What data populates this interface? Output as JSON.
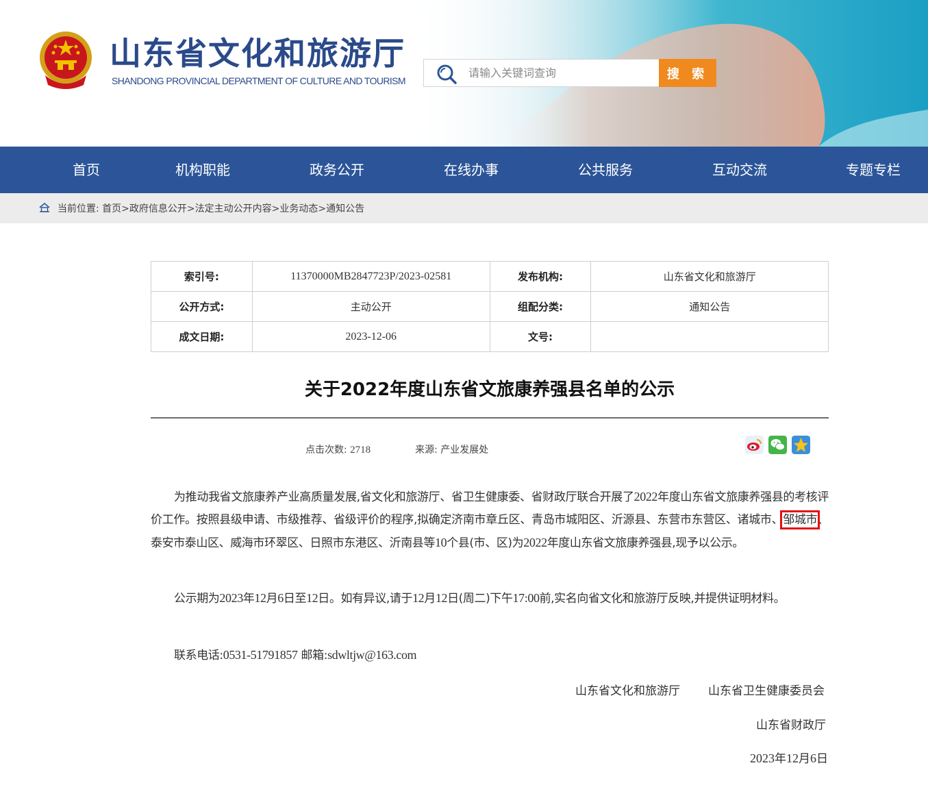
{
  "header": {
    "site_title": "山东省文化和旅游厅",
    "site_subtitle": "SHANDONG PROVINCIAL DEPARTMENT OF CULTURE AND TOURISM",
    "search_placeholder": "请输入关键词查询",
    "search_button": "搜 索",
    "emblem_icon": "national-emblem-icon",
    "colors": {
      "brand_blue": "#2a4a8a",
      "search_orange": "#f08a1e"
    }
  },
  "nav": {
    "items": [
      {
        "label": "首页"
      },
      {
        "label": "机构职能"
      },
      {
        "label": "政务公开"
      },
      {
        "label": "在线办事"
      },
      {
        "label": "公共服务"
      },
      {
        "label": "互动交流"
      },
      {
        "label": "专题专栏"
      }
    ],
    "color": "#2b5598"
  },
  "breadcrumb": {
    "prefix": "当前位置:",
    "items": [
      "首页",
      "政府信息公开",
      "法定主动公开内容",
      "业务动态",
      "通知公告"
    ]
  },
  "meta": {
    "rows": [
      {
        "label1": "索引号:",
        "value1": "11370000MB2847723P/2023-02581",
        "label2": "发布机构:",
        "value2": "山东省文化和旅游厅"
      },
      {
        "label1": "公开方式:",
        "value1": "主动公开",
        "label2": "组配分类:",
        "value2": "通知公告"
      },
      {
        "label1": "成文日期:",
        "value1": "2023-12-06",
        "label2": "文号:",
        "value2": ""
      }
    ]
  },
  "article": {
    "title": "关于2022年度山东省文旅康养强县名单的公示",
    "views_label": "点击次数:",
    "views": "2718",
    "source_label": "来源:",
    "source": "产业发展处",
    "share_icons": [
      "weibo-icon",
      "wechat-icon",
      "qzone-icon"
    ],
    "para1_a": "为推动我省文旅康养产业高质量发展,省文化和旅游厅、省卫生健康委、省财政厅联合开展了",
    "para1_year": "2022",
    "para1_b": "年度山东省文旅康养强县的考核评价工作。按照县级申请、市级推荐、省级评价的程序,拟确定济南市章丘区、青岛市城阳区、沂源县、东营市东营区、诸城市、",
    "para1_highlight": "邹城市",
    "para1_c": "、泰安市泰山区、威海市环翠区、日照市东港区、沂南县等",
    "para1_ten": "10",
    "para1_d": "个县(市、区)为",
    "para1_year2": "2022",
    "para1_e": "年度山东省文旅康养强县,现予以公示。",
    "para2_a": "公示期为",
    "para2_date1": "2023",
    "para2_b": "年",
    "para2_m1": "12",
    "para2_c": "月",
    "para2_d1": "6",
    "para2_d": "日至",
    "para2_d2": "12",
    "para2_e": "日。如有异议,请于",
    "para2_m2": "12",
    "para2_f": "月",
    "para2_d3": "12",
    "para2_g": "日(周二)下午",
    "para2_time": "17:00",
    "para2_h": "前,实名向省文化和旅游厅反映,并提供证明材料。",
    "contact_label": "联系电话:",
    "phone": "0531-51791857",
    "email_label": " 邮箱:",
    "email": "sdwltjw@163.com",
    "signer1": "山东省文化和旅游厅",
    "signer2": "山东省卫生健康委员会",
    "signer3": "山东省财政厅",
    "date_year": "2023",
    "date_y": "年",
    "date_month": "12",
    "date_m": "月",
    "date_day": "6",
    "date_d": "日"
  }
}
